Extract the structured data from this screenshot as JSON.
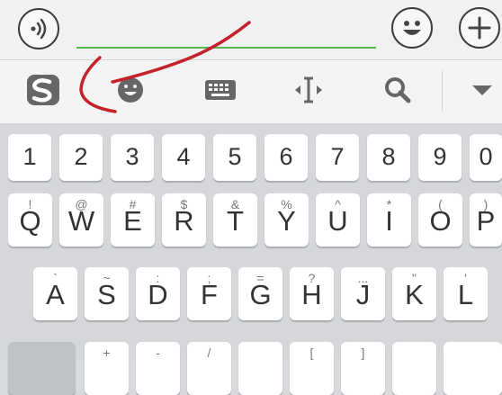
{
  "top_bar": {
    "voice_icon": "voice-wave-icon",
    "emoji_icon": "smiley-face-icon",
    "plus_icon": "plus-icon"
  },
  "toolbar": {
    "icons": [
      "sogou-logo-icon",
      "emoji-face-icon",
      "keyboard-icon",
      "cursor-move-icon",
      "search-icon",
      "collapse-triangle-icon"
    ]
  },
  "keyboard": {
    "row_numbers": [
      "1",
      "2",
      "3",
      "4",
      "5",
      "6",
      "7",
      "8",
      "9",
      "0"
    ],
    "row_qwerty": [
      {
        "main": "Q",
        "sub": "!"
      },
      {
        "main": "W",
        "sub": "@"
      },
      {
        "main": "E",
        "sub": "#"
      },
      {
        "main": "R",
        "sub": "$"
      },
      {
        "main": "T",
        "sub": "&"
      },
      {
        "main": "Y",
        "sub": "%"
      },
      {
        "main": "U",
        "sub": "^"
      },
      {
        "main": "I",
        "sub": "*"
      },
      {
        "main": "O",
        "sub": "("
      },
      {
        "main": "P",
        "sub": ")"
      }
    ],
    "row_asdf": [
      {
        "main": "A",
        "sub": "`"
      },
      {
        "main": "S",
        "sub": "~"
      },
      {
        "main": "D",
        "sub": ":"
      },
      {
        "main": "F",
        "sub": ";"
      },
      {
        "main": "G",
        "sub": "="
      },
      {
        "main": "H",
        "sub": "?"
      },
      {
        "main": "J",
        "sub": "..."
      },
      {
        "main": "K",
        "sub": "\""
      },
      {
        "main": "L",
        "sub": "'"
      }
    ],
    "row_bottom_partial": [
      {
        "sub": "+"
      },
      {
        "sub": "-"
      },
      {
        "sub": "/"
      },
      {
        "sub": ""
      },
      {
        "sub": "["
      },
      {
        "sub": "]"
      },
      {
        "sub": ""
      },
      {
        "sub": ""
      }
    ]
  },
  "colors": {
    "input_underline": "#53b84d",
    "annotation_stroke": "#c5212a",
    "logo_gray": "#666666"
  }
}
